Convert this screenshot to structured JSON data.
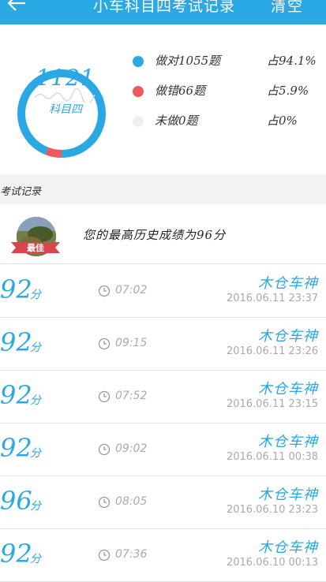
{
  "header": {
    "title": "小车科目四考试记录",
    "clear_label": "清空"
  },
  "stats": {
    "count": "1121",
    "subject": "科目四",
    "legend": [
      {
        "label": "做对1055题",
        "pct": "占94.1%",
        "color": "#2aa8e4"
      },
      {
        "label": "做错66题",
        "pct": "占5.9%",
        "color": "#f0595c"
      },
      {
        "label": "未做0题",
        "pct": "占0%",
        "color": "#eeeeee"
      }
    ],
    "ring_fractions": {
      "correct": 0.941,
      "wrong": 0.059
    }
  },
  "section": {
    "title": "考试记录"
  },
  "best": {
    "badge": "最佳",
    "text": "您的最高历史成绩为96分"
  },
  "records": [
    {
      "score": "92",
      "unit": "分",
      "duration": "07:02",
      "rank": "木仓车神",
      "datetime": "2016.06.11  23:37"
    },
    {
      "score": "92",
      "unit": "分",
      "duration": "09:15",
      "rank": "木仓车神",
      "datetime": "2016.06.11  23:26"
    },
    {
      "score": "92",
      "unit": "分",
      "duration": "07:52",
      "rank": "木仓车神",
      "datetime": "2016.06.11  23:15"
    },
    {
      "score": "92",
      "unit": "分",
      "duration": "09:02",
      "rank": "木仓车神",
      "datetime": "2016.06.11  00:38"
    },
    {
      "score": "96",
      "unit": "分",
      "duration": "08:05",
      "rank": "木仓车神",
      "datetime": "2016.06.10  23:23"
    },
    {
      "score": "92",
      "unit": "分",
      "duration": "07:36",
      "rank": "木仓车神",
      "datetime": "2016.06.10  00:13"
    }
  ]
}
